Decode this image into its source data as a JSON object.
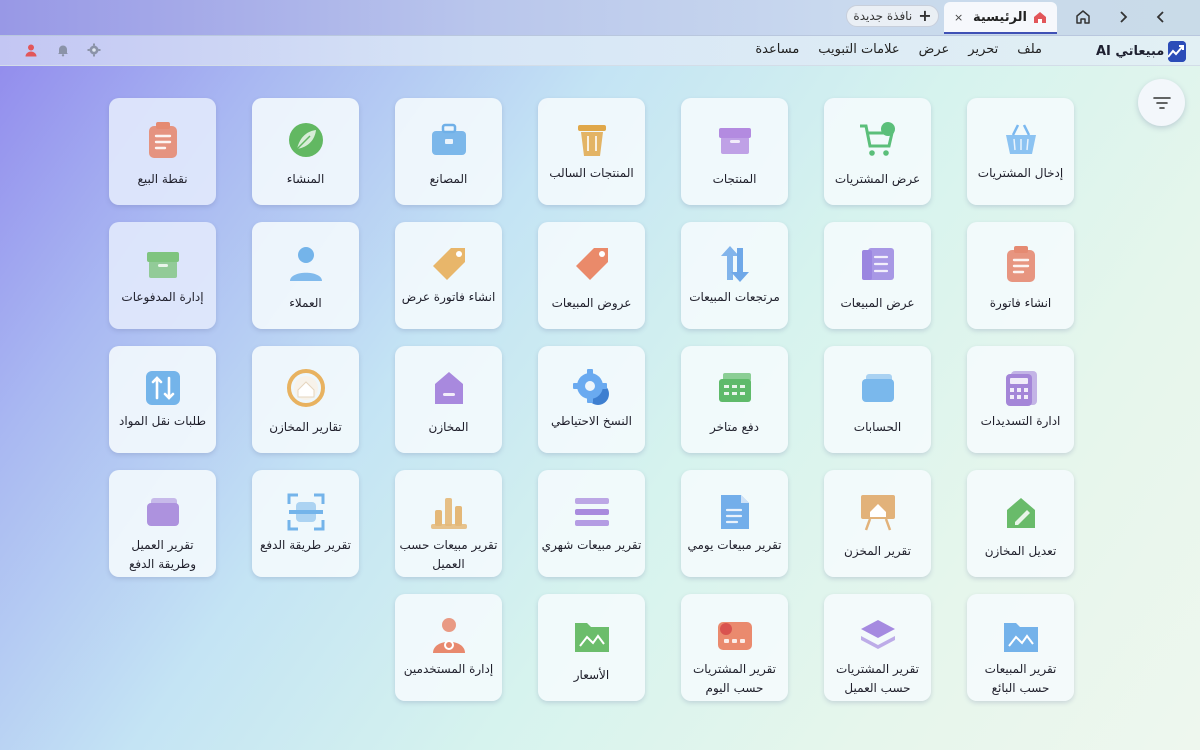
{
  "tabbar": {
    "active_tab": "الرئيسية",
    "close_glyph": "×",
    "new_tab_label": "نافذة جديدة",
    "new_tab_plus": "+"
  },
  "menubar": {
    "brand": "مبيعاتي AI",
    "items": [
      "ملف",
      "تحرير",
      "عرض",
      "علامات التبويب",
      "مساعدة"
    ]
  },
  "tiles": [
    {
      "label": "إدخال المشتريات",
      "icon": "basket-icon",
      "color": "#7ab8f0"
    },
    {
      "label": "عرض المشتريات",
      "icon": "cart-icon",
      "color": "#5bbf7a"
    },
    {
      "label": "المنتجات",
      "icon": "box-icon",
      "color": "#b38be0"
    },
    {
      "label": "المنتجات السالب",
      "icon": "trash-icon",
      "color": "#e0a84a"
    },
    {
      "label": "المصانع",
      "icon": "briefcase-icon",
      "color": "#6fb0e8"
    },
    {
      "label": "المنشاء",
      "icon": "leaf-icon",
      "color": "#62b862"
    },
    {
      "label": "نقطة البيع",
      "icon": "clipboard-icon",
      "color": "#e58a72"
    },
    {
      "label": "انشاء فاتورة",
      "icon": "clipboard-icon",
      "color": "#e58a72"
    },
    {
      "label": "عرض المبيعات",
      "icon": "book-icon",
      "color": "#9b86e0"
    },
    {
      "label": "مرتجعات المبيعات",
      "icon": "swap-icon",
      "color": "#6fa8e8"
    },
    {
      "label": "عروض المبيعات",
      "icon": "tag-icon",
      "color": "#ea8a6a"
    },
    {
      "label": "انشاء فاتورة عرض",
      "icon": "tag-icon",
      "color": "#e8b66a"
    },
    {
      "label": "العملاء",
      "icon": "user-icon",
      "color": "#74b4ea"
    },
    {
      "label": "إدارة المدفوعات",
      "icon": "box-icon",
      "color": "#7fc47f"
    },
    {
      "label": "ادارة التسديدات",
      "icon": "calculator-icon",
      "color": "#a486d8"
    },
    {
      "label": "الحسابات",
      "icon": "wallet-icon",
      "color": "#7ab8ec"
    },
    {
      "label": "دفع متاخر",
      "icon": "cash-icon",
      "color": "#5fba6a"
    },
    {
      "label": "النسخ الاحتياطي",
      "icon": "gear-icon",
      "color": "#6aaaf0"
    },
    {
      "label": "المخازن",
      "icon": "warehouse-icon",
      "color": "#a889de"
    },
    {
      "label": "تقارير المخازن",
      "icon": "store-ring-icon",
      "color": "#e8b260"
    },
    {
      "label": "طلبات نقل المواد",
      "icon": "transfer-icon",
      "color": "#74b4ea"
    },
    {
      "label": "تعديل المخازن",
      "icon": "edit-house-icon",
      "color": "#69bb6a"
    },
    {
      "label": "تقرير المخزن",
      "icon": "easel-icon",
      "color": "#e2b27a"
    },
    {
      "label": "تقرير مبيعات يومي",
      "icon": "document-icon",
      "color": "#73aeea"
    },
    {
      "label": "تقرير مبيعات شهري",
      "icon": "list-icon",
      "color": "#a98bde"
    },
    {
      "label": "تقرير مبيعات حسب العميل",
      "icon": "bar-chart-icon",
      "color": "#e4b878"
    },
    {
      "label": "تقرير طريقة الدفع",
      "icon": "scan-icon",
      "color": "#74b4ea"
    },
    {
      "label": "تقرير العميل وطريقة الدفع",
      "icon": "wallet-icon",
      "color": "#ad92de"
    },
    {
      "label": "تقرير المبيعات حسب البائع",
      "icon": "folder-chart-icon",
      "color": "#74b2ea"
    },
    {
      "label": "تقرير المشتريات حسب العميل",
      "icon": "layers-icon",
      "color": "#a58ae0"
    },
    {
      "label": "تقرير المشتريات حسب اليوم",
      "icon": "card-icon",
      "color": "#ea8a6e"
    },
    {
      "label": "الأسعار",
      "icon": "folder-chart-icon",
      "color": "#6cbd6c"
    },
    {
      "label": "إدارة المستخدمين",
      "icon": "user-gear-icon",
      "color": "#e8896e"
    }
  ]
}
